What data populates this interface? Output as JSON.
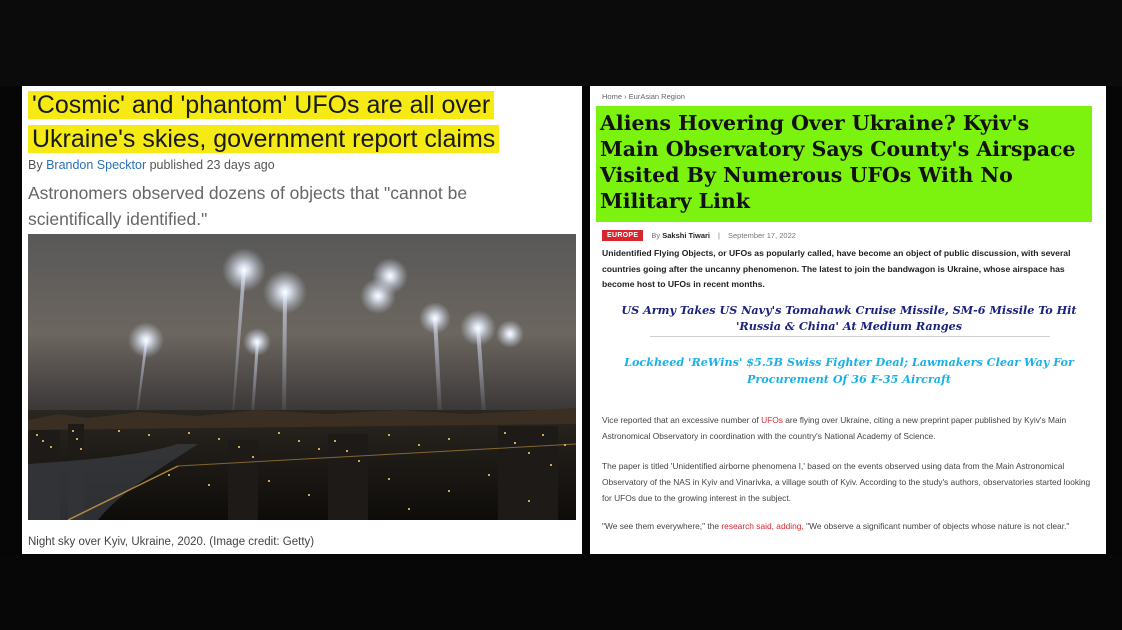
{
  "left_article": {
    "headline": "'Cosmic' and 'phantom' UFOs are all over Ukraine's skies, government report claims",
    "byline_prefix": "By ",
    "author": "Brandon Specktor",
    "published": " published 23 days ago",
    "lede": "Astronomers observed dozens of objects that \"cannot be scientifically identified.\"",
    "caption": "Night sky over Kyiv, Ukraine, 2020. (Image credit: Getty)",
    "highlight_color": "#f5ea14"
  },
  "right_article": {
    "breadcrumb": "Home › EurAsian Region",
    "headline": "Aliens Hovering Over Ukraine? Kyiv's Main Observatory Says County's Airspace Visited By Numerous UFOs With No Military Link",
    "highlight_color": "#7cf20f",
    "category": "EUROPE",
    "by_prefix": "By ",
    "author": "Sakshi Tiwari",
    "separator": "|",
    "date": "September 17, 2022",
    "intro": "Unidentified Flying Objects, or UFOs as popularly called, have become an object of public discussion, with several countries going after the uncanny phenomenon. The latest to join the bandwagon is Ukraine, whose airspace has become host to UFOs in recent months.",
    "related_1": "US Army Takes US Navy's Tomahawk Cruise Missile, SM-6 Missile To Hit 'Russia & China' At Medium Ranges",
    "related_2": "Lockheed 'ReWins' $5.5B Swiss Fighter Deal; Lawmakers Clear Way For Procurement Of 36 F-35 Aircraft",
    "p1_a": "Vice reported that an excessive number of ",
    "p1_link": "UFOs",
    "p1_b": " are flying over Ukraine, citing a new preprint paper published by Kyiv's Main Astronomical Observatory in coordination with the country's National Academy of Science.",
    "p2": "The paper is titled 'Unidentified airborne phenomena I,' based on the events observed using data from the Main Astronomical Observatory of the NAS in Kyiv and Vinarivka, a village south of Kyiv. According to the study's authors, observatories started looking for UFOs due to the growing interest in the subject.",
    "p3_a": "\"We see them everywhere,\" the ",
    "p3_link": "research said, adding,",
    "p3_b": " \"We observe a significant number of objects whose nature is not clear.\"",
    "link_color": "#d8262e"
  }
}
